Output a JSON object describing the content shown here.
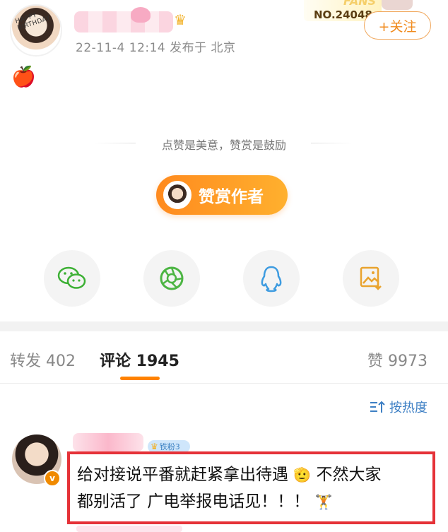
{
  "post": {
    "timestamp_location": "22-11-4 12:14  发布于 北京",
    "avatar_text": "HAPPY BIRTHDAY",
    "content_emoji": "🍎",
    "fans_word": "FANS",
    "fans_number": "NO.24048",
    "follow_label": "+关注"
  },
  "reward": {
    "slogan": "点赞是美意，赞赏是鼓励",
    "button_label": "赞赏作者"
  },
  "share": {
    "items": [
      "wechat",
      "moments",
      "qq",
      "save-image"
    ]
  },
  "tabs": {
    "repost": "转发 402",
    "comments": "评论 1945",
    "likes": "赞 9973"
  },
  "sort": {
    "label": "按热度"
  },
  "comment": {
    "fan_badge": "铁粉3",
    "vip_mark": "v",
    "line1": "给对接说平番就赶紧拿出待遇",
    "line1_after": "不然大家",
    "line2": "都别活了 广电举报电话见！！！",
    "emoji1": "🫡",
    "emoji2": "🏋"
  },
  "colors": {
    "accent_orange": "#ff8200",
    "highlight_red": "#e53238",
    "link_blue": "#3d7fc4"
  }
}
